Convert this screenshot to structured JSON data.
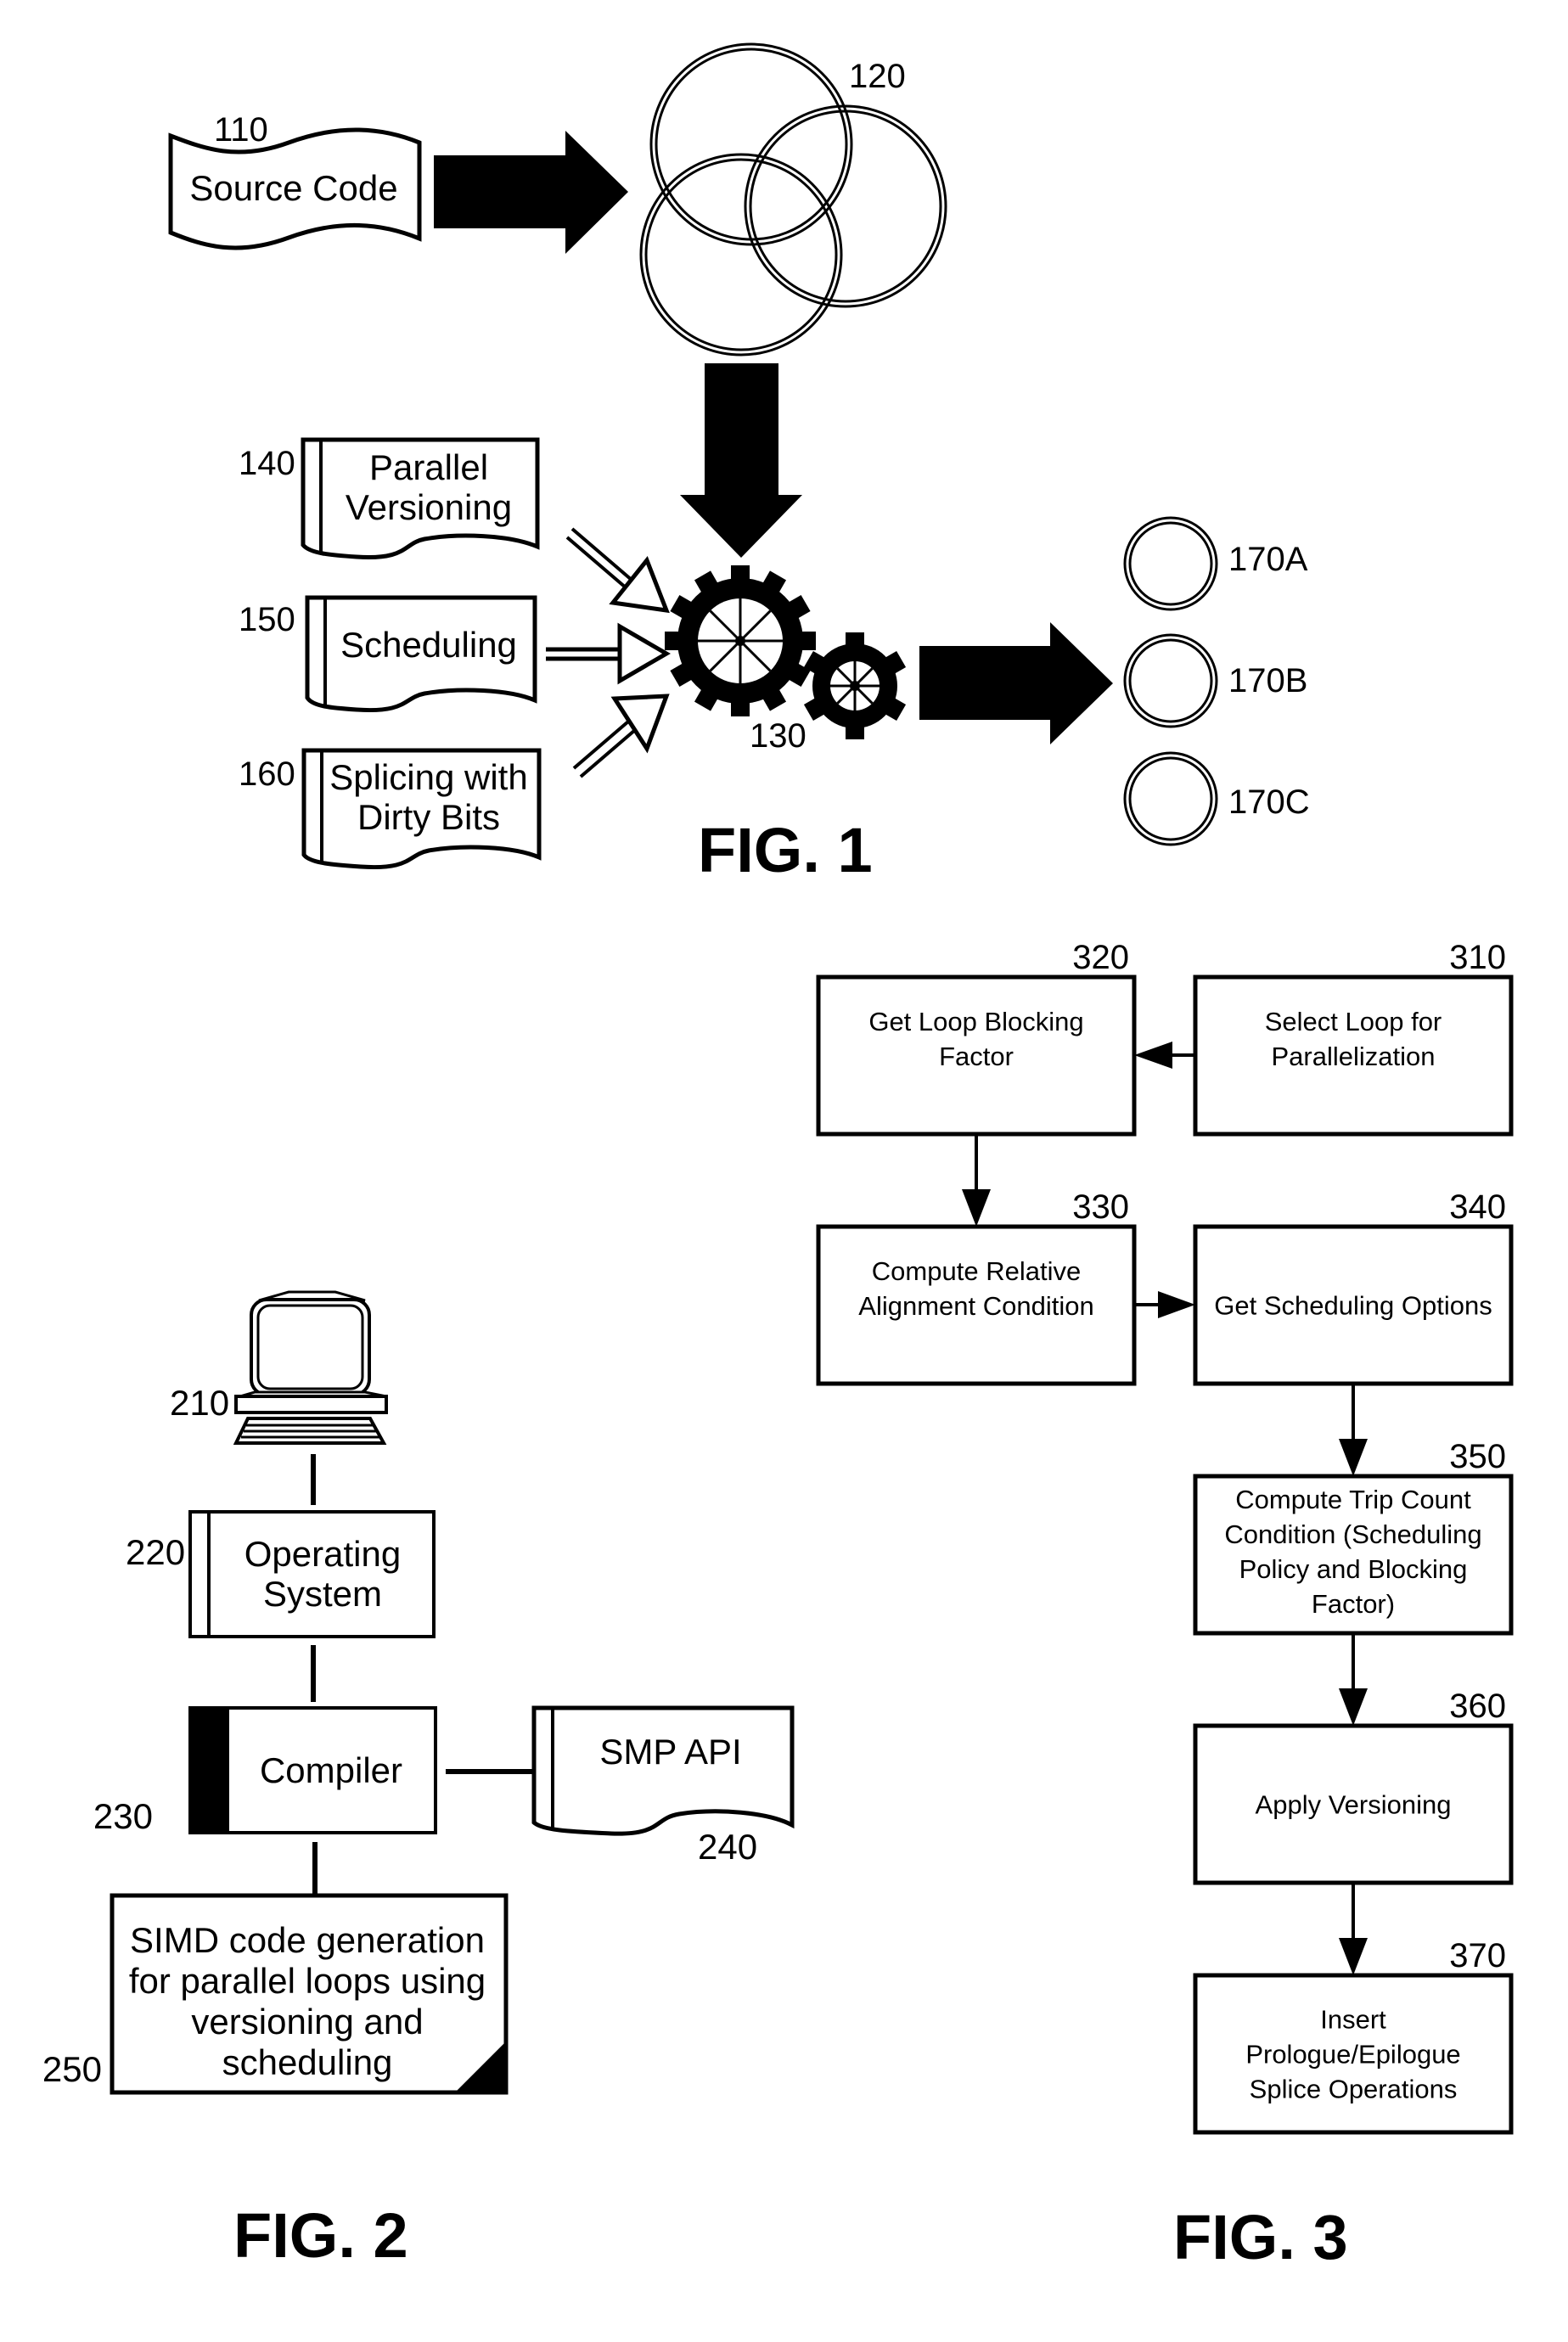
{
  "colors": {
    "ink": "#000000",
    "paper": "#ffffff"
  },
  "fig1": {
    "caption": "FIG. 1",
    "source_code": {
      "ref": "110",
      "label": "Source Code",
      "icon": "wavy-flag-document"
    },
    "code_rings": {
      "ref": "120",
      "icon": "three-overlapping-rings"
    },
    "compiler_gears": {
      "ref": "130",
      "icon": "gears"
    },
    "inputs": [
      {
        "ref": "140",
        "lines": [
          "Parallel",
          "Versioning"
        ]
      },
      {
        "ref": "150",
        "lines": [
          "Scheduling"
        ]
      },
      {
        "ref": "160",
        "lines": [
          "Splicing with",
          "Dirty Bits"
        ]
      }
    ],
    "outputs": [
      {
        "ref": "170A"
      },
      {
        "ref": "170B"
      },
      {
        "ref": "170C"
      }
    ]
  },
  "fig2": {
    "caption": "FIG. 2",
    "computer": {
      "ref": "210",
      "icon": "desktop-computer"
    },
    "operating_system": {
      "ref": "220",
      "lines": [
        "Operating",
        "System"
      ]
    },
    "compiler": {
      "ref": "230",
      "label": "Compiler"
    },
    "smp_api": {
      "ref": "240",
      "label": "SMP API"
    },
    "simd_module": {
      "ref": "250",
      "lines": [
        "SIMD code generation",
        "for parallel loops using",
        "versioning and",
        "scheduling"
      ]
    }
  },
  "fig3": {
    "caption": "FIG. 3",
    "steps": [
      {
        "ref": "310",
        "lines": [
          "Select Loop for",
          "Parallelization"
        ]
      },
      {
        "ref": "320",
        "lines": [
          "Get Loop Blocking",
          "Factor"
        ]
      },
      {
        "ref": "330",
        "lines": [
          "Compute Relative",
          "Alignment Condition"
        ]
      },
      {
        "ref": "340",
        "lines": [
          "Get Scheduling Options"
        ]
      },
      {
        "ref": "350",
        "lines": [
          "Compute Trip Count",
          "Condition (Scheduling",
          "Policy and Blocking",
          "Factor)"
        ]
      },
      {
        "ref": "360",
        "lines": [
          "Apply Versioning"
        ]
      },
      {
        "ref": "370",
        "lines": [
          "Insert",
          "Prologue/Epilogue",
          "Splice Operations"
        ]
      }
    ]
  }
}
